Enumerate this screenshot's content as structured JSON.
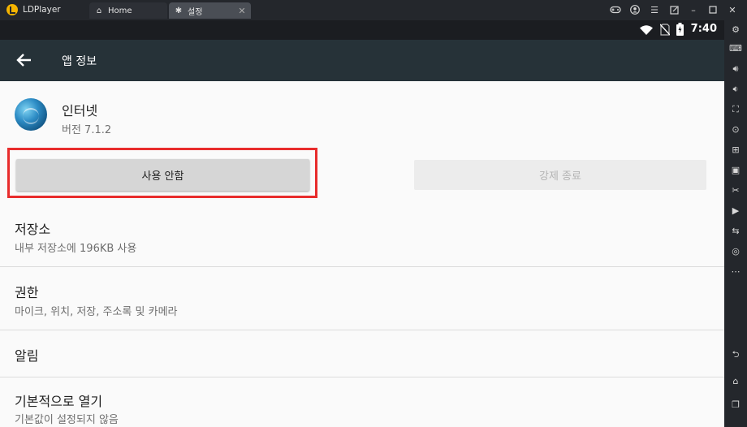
{
  "window": {
    "app_name": "LDPlayer",
    "tabs": [
      {
        "label": "Home",
        "icon": "home-icon"
      },
      {
        "label": "설정",
        "icon": "settings-gear-icon"
      }
    ]
  },
  "status_bar": {
    "time": "7:40",
    "icons": [
      "wifi-icon",
      "no-sim-icon",
      "battery-charging-icon"
    ]
  },
  "app_bar": {
    "title": "앱 정보",
    "back_icon": "back-arrow-icon"
  },
  "app": {
    "name": "인터넷",
    "version": "버전 7.1.2"
  },
  "buttons": {
    "disable_label": "사용 안함",
    "force_stop_label": "강제 종료",
    "force_stop_enabled": false
  },
  "items": [
    {
      "title": "저장소",
      "subtitle": "내부 저장소에 196KB 사용"
    },
    {
      "title": "권한",
      "subtitle": "마이크, 위치, 저장, 주소록 및 카메라"
    },
    {
      "title": "알림",
      "subtitle": ""
    },
    {
      "title": "기본적으로 열기",
      "subtitle": "기본값이 설정되지 않음"
    }
  ],
  "colors": {
    "app_bar": "#263238",
    "highlight": "#e82c2c",
    "status_bar": "#1b1d21"
  }
}
